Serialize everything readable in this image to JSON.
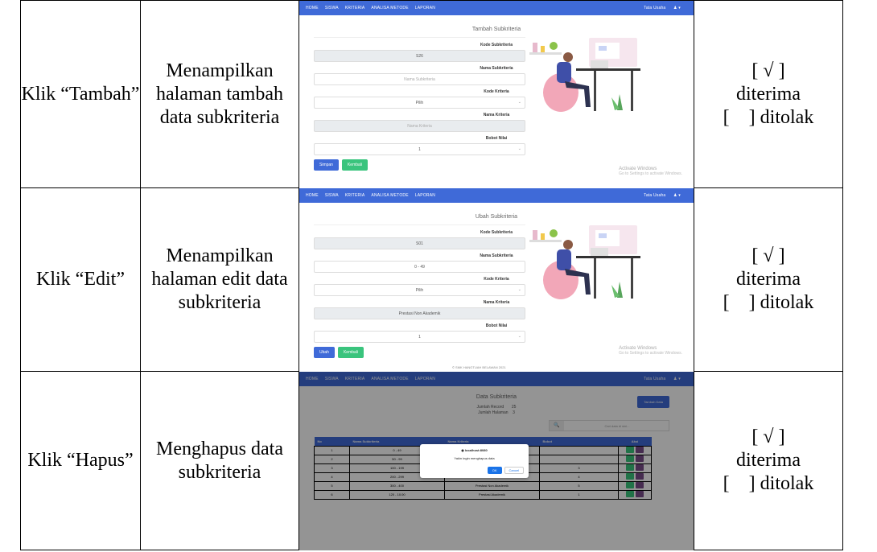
{
  "rows": [
    {
      "action": "Klik “Tambah”",
      "expected": "Menampilkan halaman tambah data subkriteria",
      "result_accepted": "[ √ ] diterima",
      "result_rejected": "[    ] ditolak"
    },
    {
      "action": "Klik “Edit”",
      "expected": "Menampilkan halaman edit data subkriteria",
      "result_accepted": "[ √ ] diterima",
      "result_rejected": "[    ] ditolak"
    },
    {
      "action": "Klik “Hapus”",
      "expected": "Menghapus data subkriteria",
      "result_accepted": "[ √ ] diterima",
      "result_rejected": "[    ] ditolak"
    }
  ],
  "nav": {
    "items": [
      "HOME",
      "SISWA",
      "KRITERIA",
      "ANALISA METODE",
      "LAPORAN"
    ],
    "user": "Tata Usaha"
  },
  "shot1": {
    "title": "Tambah Subkriteria",
    "kode_sub_label": "Kode Subkriteria",
    "kode_sub_value": "S26",
    "nama_sub_label": "Nama Subkriteria",
    "nama_sub_placeholder": "Nama Subkriteria",
    "kode_krit_label": "Kode Kriteria",
    "kode_krit_value": "Pilih",
    "nama_krit_label": "Nama Kriteria",
    "nama_krit_placeholder": "Nama Kriteria",
    "bobot_label": "Bobot Nilai",
    "bobot_value": "1",
    "btn_save": "Simpan",
    "btn_back": "Kembali"
  },
  "shot2": {
    "title": "Ubah Subkriteria",
    "kode_sub_label": "Kode Subkriteria",
    "kode_sub_value": "S01",
    "nama_sub_label": "Nama Subkriteria",
    "nama_sub_value": "0 - 49",
    "kode_krit_label": "Kode Kriteria",
    "kode_krit_value": "Pilih",
    "nama_krit_label": "Nama Kriteria",
    "nama_krit_value": "Prestasi Non Akademik",
    "bobot_label": "Bobot Nilai",
    "bobot_value": "1",
    "btn_save": "Ubah",
    "btn_back": "Kembali",
    "footer": "© SMK HANGTUAH BELAWAN 2021"
  },
  "activate": {
    "title": "Activate Windows",
    "sub": "Go to Settings to activate Windows."
  },
  "shot3": {
    "title": "Data Subkriteria",
    "jumlah_record_label": "Jumlah Record",
    "jumlah_record_value": "25",
    "jumlah_halaman_label": "Jumlah Halaman",
    "jumlah_halaman_value": "3",
    "tambah_btn": "Tambah Data",
    "search_placeholder": "Cari data di sini...",
    "columns": [
      "No",
      "Nama Subkriteria",
      "Nama Kriteria",
      "Bobot",
      "Aksi"
    ],
    "table_rows": [
      {
        "no": "1",
        "nama": "0 - 49",
        "krit": "",
        "bobot": ""
      },
      {
        "no": "2",
        "nama": "50 - 99",
        "krit": "",
        "bobot": ""
      },
      {
        "no": "3",
        "nama": "100 - 199",
        "krit": "Prestasi Non Akademik",
        "bobot": "3"
      },
      {
        "no": "4",
        "nama": "200 - 299",
        "krit": "Prestasi Non Akademik",
        "bobot": "4"
      },
      {
        "no": "5",
        "nama": "300 - 400",
        "krit": "Prestasi Non Akademik",
        "bobot": "5"
      },
      {
        "no": "6",
        "nama": "120 - 10.00",
        "krit": "Prestasi Akademik",
        "bobot": "1"
      }
    ],
    "dialog_host": "localhost:8080",
    "dialog_msg": "Yakin ingin menghapus data",
    "dialog_ok": "OK",
    "dialog_cancel": "Cancel"
  }
}
